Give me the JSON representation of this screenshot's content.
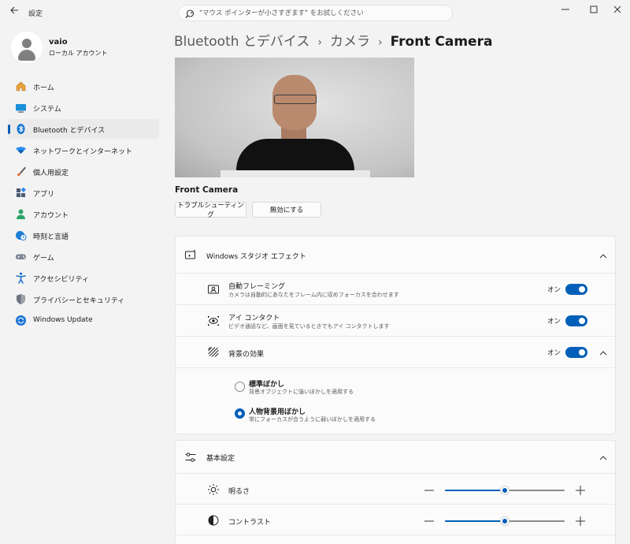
{
  "app": {
    "title": "設定"
  },
  "search": {
    "placeholder": "\"マウス ポインターが小さすぎます\" をお試しください"
  },
  "profile": {
    "name": "vaio",
    "account_type": "ローカル アカウント"
  },
  "sidebar": {
    "items": [
      {
        "label": "ホーム",
        "icon": "home-icon"
      },
      {
        "label": "システム",
        "icon": "system-icon"
      },
      {
        "label": "Bluetooth とデバイス",
        "icon": "bluetooth-icon",
        "active": true
      },
      {
        "label": "ネットワークとインターネット",
        "icon": "wifi-icon"
      },
      {
        "label": "個人用設定",
        "icon": "brush-icon"
      },
      {
        "label": "アプリ",
        "icon": "apps-icon"
      },
      {
        "label": "アカウント",
        "icon": "account-icon"
      },
      {
        "label": "時刻と言語",
        "icon": "globe-clock-icon"
      },
      {
        "label": "ゲーム",
        "icon": "gamepad-icon"
      },
      {
        "label": "アクセシビリティ",
        "icon": "accessibility-icon"
      },
      {
        "label": "プライバシーとセキュリティ",
        "icon": "shield-icon"
      },
      {
        "label": "Windows Update",
        "icon": "update-icon"
      }
    ]
  },
  "breadcrumb": {
    "level1": "Bluetooth とデバイス",
    "level2": "カメラ",
    "current": "Front Camera",
    "separator": "›"
  },
  "camera": {
    "name": "Front Camera",
    "troubleshoot_label": "トラブルシューティング",
    "disable_label": "無効にする"
  },
  "studio_effects": {
    "title": "Windows スタジオ エフェクト",
    "auto_framing": {
      "title": "自動フレーミング",
      "desc": "カメラは自動的にあなたをフレーム内に収めフォーカスを合わせます",
      "state": "オン",
      "on": true
    },
    "eye_contact": {
      "title": "アイ コンタクト",
      "desc": "ビデオ通話など、画面を見ているときでもアイ コンタクトします",
      "state": "オン",
      "on": true
    },
    "background": {
      "title": "背景の効果",
      "state": "オン",
      "on": true,
      "options": [
        {
          "title": "標準ぼかし",
          "desc": "背景オブジェクトに強いぼかしを適用する",
          "checked": false
        },
        {
          "title": "人物背景用ぼかし",
          "desc": "常にフォーカスが合うように弱いぼかしを適用する",
          "checked": true
        }
      ]
    }
  },
  "basic_settings": {
    "title": "基本設定",
    "brightness": {
      "label": "明るさ",
      "value": 0.5
    },
    "contrast": {
      "label": "コントラスト",
      "value": 0.5
    }
  },
  "colors": {
    "accent": "#005fb8",
    "background": "#f3f3f3",
    "card": "#fbfbfb"
  }
}
